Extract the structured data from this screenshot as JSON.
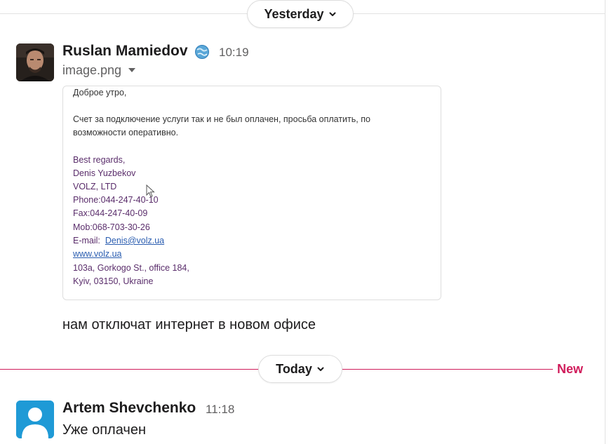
{
  "dividers": {
    "yesterday_label": "Yesterday",
    "today_label": "Today",
    "new_label": "New",
    "new_color": "#d01c5b"
  },
  "messages": [
    {
      "sender": "Ruslan Mamiedov",
      "status_icon": "globe-status-icon",
      "time": "10:19",
      "file_name": "image.png",
      "attachment": {
        "greeting": "Доброе утро,",
        "body_line1": "Счет за подключение услуги так и не был оплачен, просьба оплатить, по",
        "body_line2": "возможности оперативно.",
        "signature": {
          "regards": "Best regards,",
          "name": "Denis Yuzbekov",
          "company": "VOLZ, LTD",
          "phone": "Phone:044-247-40-10",
          "fax": "Fax:044-247-40-09",
          "mob": "Mob:068-703-30-26",
          "email_label": "E-mail:",
          "email": "Denis@volz.ua",
          "website": "www.volz.ua",
          "address1": "103a, Gorkogo St., office 184,",
          "address2": "Kyiv, 03150, Ukraine"
        }
      },
      "text": "нам отключат интернет в новом офисе"
    },
    {
      "sender": "Artem Shevchenko",
      "time": "11:18",
      "text": "Уже оплачен"
    }
  ]
}
